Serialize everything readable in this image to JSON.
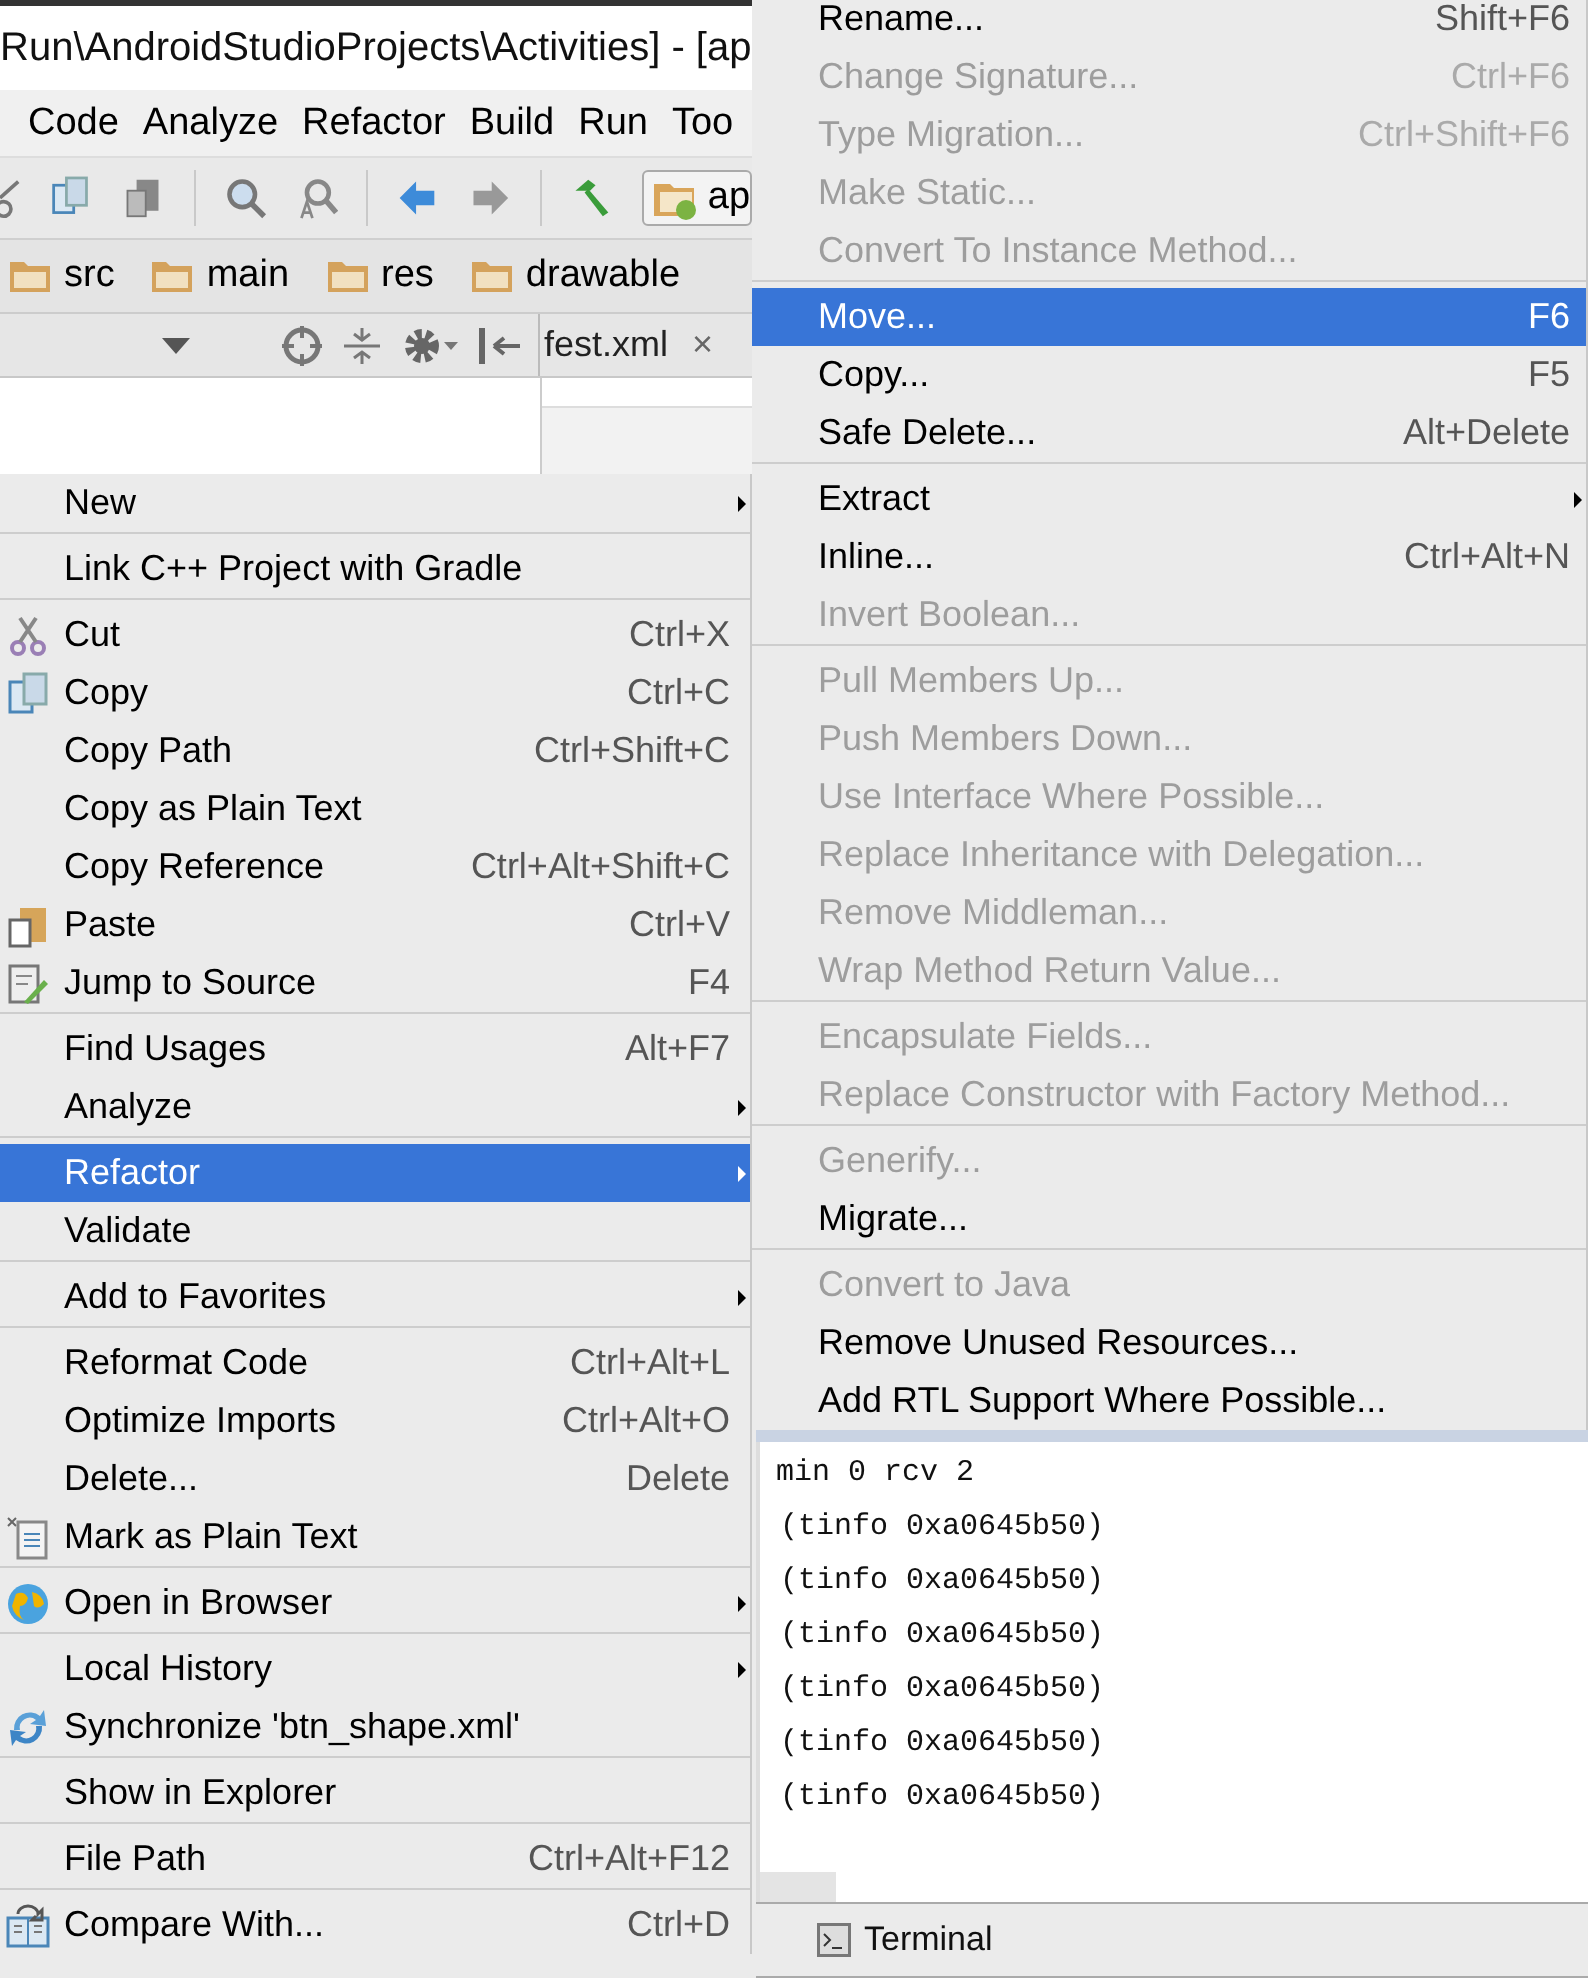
{
  "ide": {
    "title": "Run\\AndroidStudioProjects\\Activities] - [ap",
    "menu_bar": [
      "Code",
      "Analyze",
      "Refactor",
      "Build",
      "Run",
      "Too"
    ],
    "run_config": "ap",
    "breadcrumbs": [
      "src",
      "main",
      "res",
      "drawable"
    ],
    "editor_tab": {
      "label": "fest.xml",
      "close": "×"
    }
  },
  "context_menu": {
    "groups": [
      [
        {
          "label": "New",
          "submenu": true,
          "selected": false,
          "disabled": false
        }
      ],
      [
        {
          "label": "Link C++ Project with Gradle",
          "submenu": false,
          "selected": false,
          "disabled": false
        }
      ],
      [
        {
          "label": "Cut",
          "shortcut": "Ctrl+X",
          "kind": "scissors",
          "submenu": false,
          "selected": false,
          "disabled": false
        },
        {
          "label": "Copy",
          "shortcut": "Ctrl+C",
          "kind": "copy",
          "submenu": false,
          "selected": false,
          "disabled": false
        },
        {
          "label": "Copy Path",
          "shortcut": "Ctrl+Shift+C",
          "submenu": false,
          "selected": false,
          "disabled": false
        },
        {
          "label": "Copy as Plain Text",
          "submenu": false,
          "selected": false,
          "disabled": false
        },
        {
          "label": "Copy Reference",
          "shortcut": "Ctrl+Alt+Shift+C",
          "submenu": false,
          "selected": false,
          "disabled": false
        },
        {
          "label": "Paste",
          "shortcut": "Ctrl+V",
          "kind": "paste",
          "submenu": false,
          "selected": false,
          "disabled": false
        },
        {
          "label": "Jump to Source",
          "shortcut": "F4",
          "kind": "edit",
          "submenu": false,
          "selected": false,
          "disabled": false
        }
      ],
      [
        {
          "label": "Find Usages",
          "shortcut": "Alt+F7",
          "submenu": false,
          "selected": false,
          "disabled": false
        },
        {
          "label": "Analyze",
          "submenu": true,
          "selected": false,
          "disabled": false
        }
      ],
      [
        {
          "label": "Refactor",
          "submenu": true,
          "selected": true,
          "disabled": false
        },
        {
          "label": "Validate",
          "submenu": false,
          "selected": false,
          "disabled": false
        }
      ],
      [
        {
          "label": "Add to Favorites",
          "submenu": true,
          "selected": false,
          "disabled": false
        }
      ],
      [
        {
          "label": "Reformat Code",
          "shortcut": "Ctrl+Alt+L",
          "submenu": false,
          "selected": false,
          "disabled": false
        },
        {
          "label": "Optimize Imports",
          "shortcut": "Ctrl+Alt+O",
          "submenu": false,
          "selected": false,
          "disabled": false
        },
        {
          "label": "Delete...",
          "shortcut": "Delete",
          "submenu": false,
          "selected": false,
          "disabled": false
        },
        {
          "label": "Mark as Plain Text",
          "kind": "text-file",
          "submenu": false,
          "selected": false,
          "disabled": false
        }
      ],
      [
        {
          "label": "Open in Browser",
          "kind": "globe",
          "submenu": true,
          "selected": false,
          "disabled": false
        }
      ],
      [
        {
          "label": "Local History",
          "submenu": true,
          "selected": false,
          "disabled": false
        },
        {
          "label": "Synchronize 'btn_shape.xml'",
          "kind": "sync",
          "submenu": false,
          "selected": false,
          "disabled": false
        }
      ],
      [
        {
          "label": "Show in Explorer",
          "submenu": false,
          "selected": false,
          "disabled": false
        }
      ],
      [
        {
          "label": "File Path",
          "shortcut": "Ctrl+Alt+F12",
          "submenu": false,
          "selected": false,
          "disabled": false
        }
      ],
      [
        {
          "label": "Compare With...",
          "shortcut": "Ctrl+D",
          "kind": "compare",
          "submenu": false,
          "selected": false,
          "disabled": false
        }
      ]
    ]
  },
  "refactor_submenu": {
    "groups": [
      [
        {
          "label": "Rename...",
          "shortcut": "Shift+F6",
          "submenu": false,
          "selected": false,
          "disabled": false
        },
        {
          "label": "Change Signature...",
          "shortcut": "Ctrl+F6",
          "submenu": false,
          "selected": false,
          "disabled": true
        },
        {
          "label": "Type Migration...",
          "shortcut": "Ctrl+Shift+F6",
          "submenu": false,
          "selected": false,
          "disabled": true
        },
        {
          "label": "Make Static...",
          "submenu": false,
          "selected": false,
          "disabled": true
        },
        {
          "label": "Convert To Instance Method...",
          "submenu": false,
          "selected": false,
          "disabled": true
        }
      ],
      [
        {
          "label": "Move...",
          "shortcut": "F6",
          "submenu": false,
          "selected": true,
          "disabled": false
        },
        {
          "label": "Copy...",
          "shortcut": "F5",
          "submenu": false,
          "selected": false,
          "disabled": false
        },
        {
          "label": "Safe Delete...",
          "shortcut": "Alt+Delete",
          "submenu": false,
          "selected": false,
          "disabled": false
        }
      ],
      [
        {
          "label": "Extract",
          "submenu": true,
          "selected": false,
          "disabled": false
        },
        {
          "label": "Inline...",
          "shortcut": "Ctrl+Alt+N",
          "submenu": false,
          "selected": false,
          "disabled": false
        },
        {
          "label": "Invert Boolean...",
          "submenu": false,
          "selected": false,
          "disabled": true
        }
      ],
      [
        {
          "label": "Pull Members Up...",
          "submenu": false,
          "selected": false,
          "disabled": true
        },
        {
          "label": "Push Members Down...",
          "submenu": false,
          "selected": false,
          "disabled": true
        },
        {
          "label": "Use Interface Where Possible...",
          "submenu": false,
          "selected": false,
          "disabled": true
        },
        {
          "label": "Replace Inheritance with Delegation...",
          "submenu": false,
          "selected": false,
          "disabled": true
        },
        {
          "label": "Remove Middleman...",
          "submenu": false,
          "selected": false,
          "disabled": true
        },
        {
          "label": "Wrap Method Return Value...",
          "submenu": false,
          "selected": false,
          "disabled": true
        }
      ],
      [
        {
          "label": "Encapsulate Fields...",
          "submenu": false,
          "selected": false,
          "disabled": true
        },
        {
          "label": "Replace Constructor with Factory Method...",
          "submenu": false,
          "selected": false,
          "disabled": true
        }
      ],
      [
        {
          "label": "Generify...",
          "submenu": false,
          "selected": false,
          "disabled": true
        },
        {
          "label": "Migrate...",
          "submenu": false,
          "selected": false,
          "disabled": false
        }
      ],
      [
        {
          "label": "Convert to Java",
          "submenu": false,
          "selected": false,
          "disabled": true
        },
        {
          "label": "Remove Unused Resources...",
          "submenu": false,
          "selected": false,
          "disabled": false
        },
        {
          "label": "Add RTL Support Where Possible...",
          "submenu": false,
          "selected": false,
          "disabled": false
        }
      ]
    ]
  },
  "console": {
    "lines": [
      "min 0 rcv 2",
      "(tinfo 0xa0645b50)",
      "(tinfo 0xa0645b50)",
      "(tinfo 0xa0645b50)",
      "(tinfo 0xa0645b50)",
      "(tinfo 0xa0645b50)",
      "(tinfo 0xa0645b50)"
    ]
  },
  "tool_window_bar": {
    "tabs": [
      {
        "label": "Terminal"
      }
    ]
  }
}
